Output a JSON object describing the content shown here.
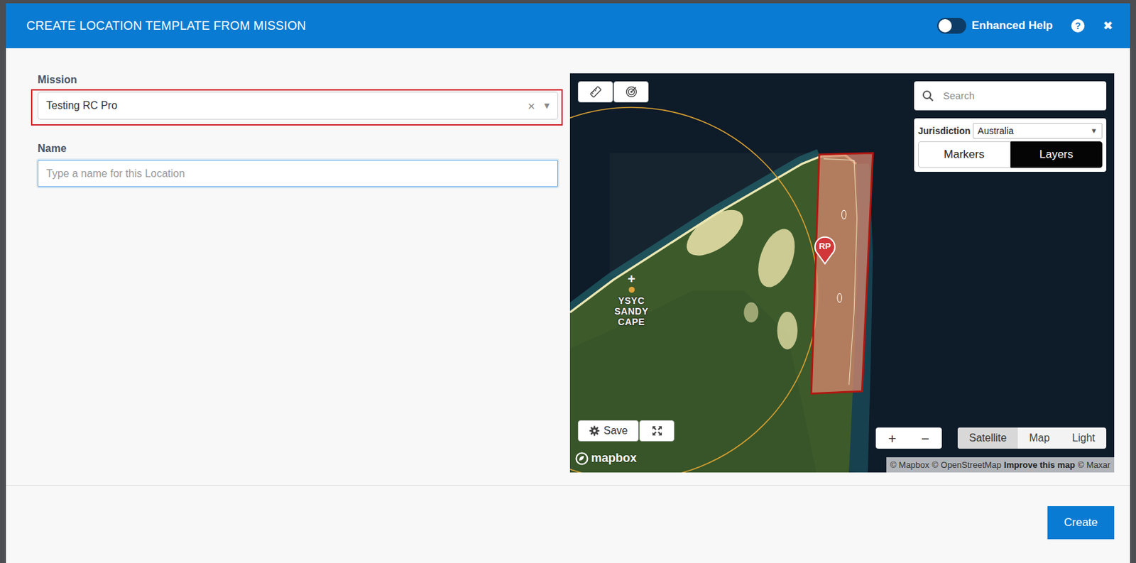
{
  "dialog": {
    "title": "CREATE LOCATION TEMPLATE FROM MISSION",
    "enhanced_help": {
      "label": "Enhanced Help",
      "on": false
    },
    "help_icon": "?",
    "close": "✖"
  },
  "form": {
    "mission": {
      "label": "Mission",
      "value": "Testing RC Pro",
      "clear": "×",
      "caret": "▾",
      "highlighted": true
    },
    "name": {
      "label": "Name",
      "placeholder": "Type a name for this Location",
      "focused": true
    }
  },
  "map": {
    "search": {
      "placeholder": "Search"
    },
    "jurisdiction": {
      "label": "Jurisdiction",
      "value": "Australia",
      "caret": "▾"
    },
    "view_toggle": [
      {
        "label": "Markers",
        "selected": false
      },
      {
        "label": "Layers",
        "selected": true
      }
    ],
    "save": {
      "label": "Save"
    },
    "zoom": [
      "+",
      "−"
    ],
    "styles": [
      {
        "label": "Satellite",
        "selected": true
      },
      {
        "label": "Map",
        "selected": false
      },
      {
        "label": "Light",
        "selected": false
      }
    ],
    "logo": "mapbox",
    "attribution": [
      {
        "text": "© Mapbox",
        "kind": "text"
      },
      {
        "text": "© OpenStreetMap",
        "kind": "text"
      },
      {
        "text": "Improve this map",
        "kind": "link"
      },
      {
        "text": "© Maxar",
        "kind": "text"
      }
    ],
    "pin": {
      "label": "RP"
    },
    "airport": {
      "symbol": "+",
      "label": "YSYC SANDY CAPE"
    }
  },
  "buttons": [
    "Create"
  ]
}
